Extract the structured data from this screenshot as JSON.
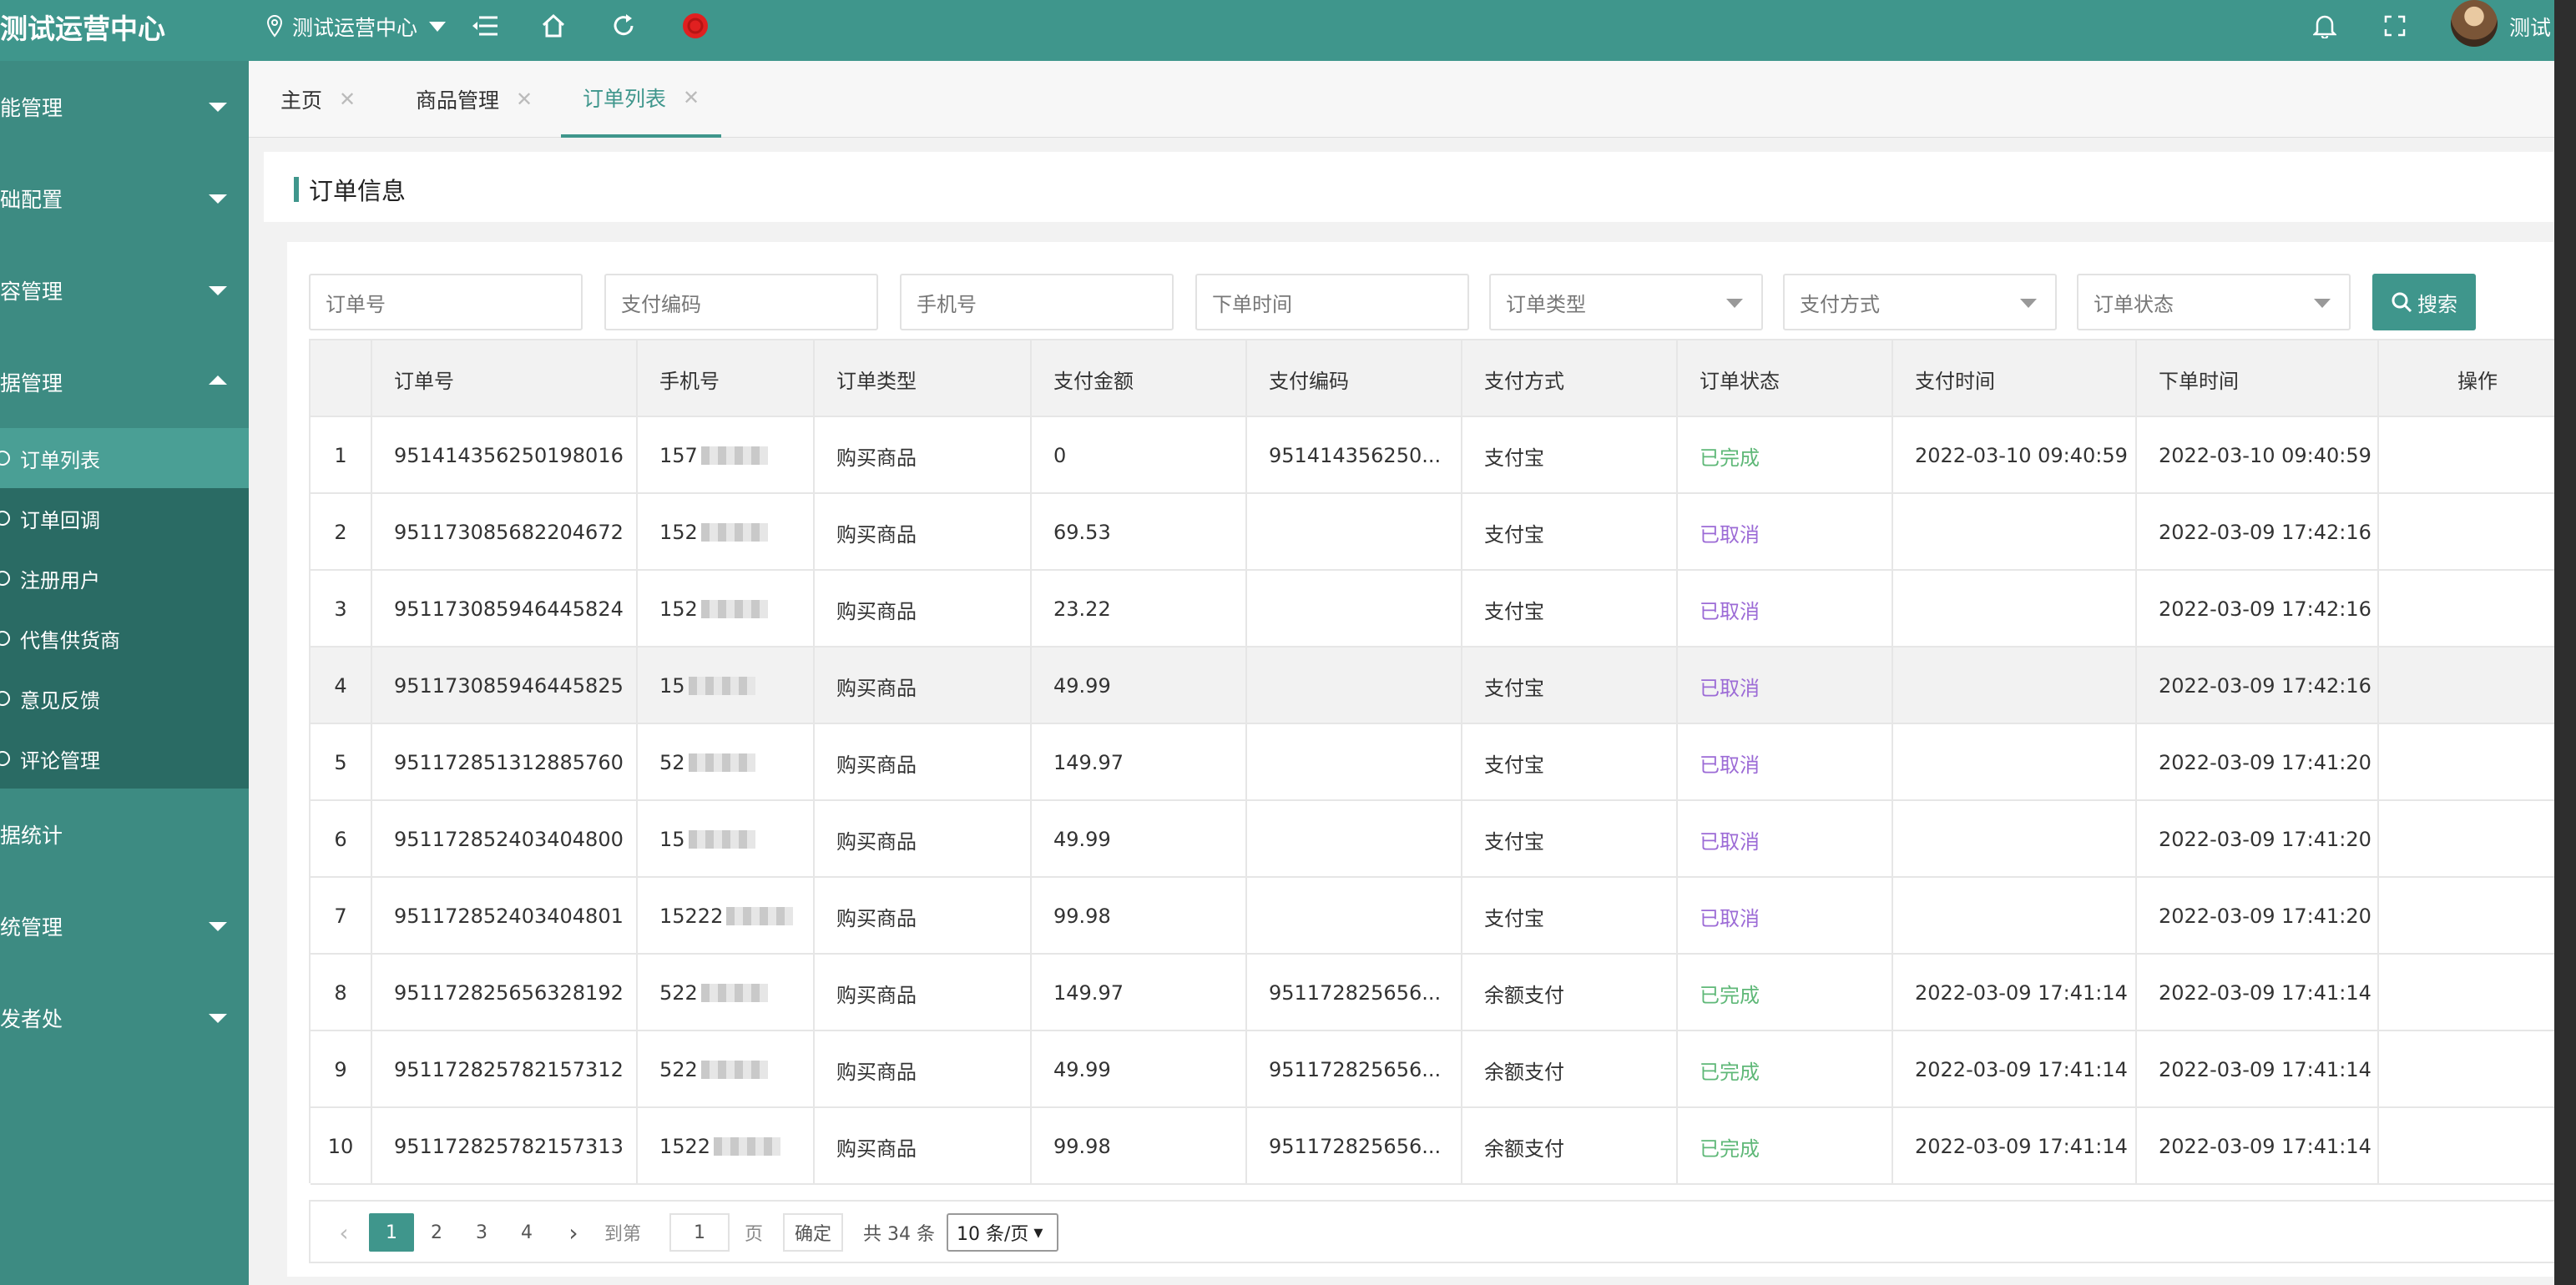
{
  "header": {
    "brand": "测试运营中心",
    "org": "测试运营中心",
    "user": "测试"
  },
  "sidebar": {
    "groups": [
      {
        "label": "能管理"
      },
      {
        "label": "础配置"
      },
      {
        "label": "容管理"
      },
      {
        "label": "据管理"
      }
    ],
    "sub_items": [
      {
        "label": "订单列表"
      },
      {
        "label": "订单回调"
      },
      {
        "label": "注册用户"
      },
      {
        "label": "代售供货商"
      },
      {
        "label": "意见反馈"
      },
      {
        "label": "评论管理"
      }
    ],
    "after": [
      {
        "label": "据统计"
      },
      {
        "label": "统管理"
      },
      {
        "label": "发者处"
      }
    ]
  },
  "tabs": [
    {
      "label": "主页"
    },
    {
      "label": "商品管理"
    },
    {
      "label": "订单列表"
    }
  ],
  "panel": {
    "title": "订单信息"
  },
  "filters": {
    "order_no": "订单号",
    "pay_code": "支付编码",
    "phone": "手机号",
    "order_time": "下单时间",
    "order_type": "订单类型",
    "pay_method": "支付方式",
    "order_status": "订单状态",
    "search_label": "搜索"
  },
  "table": {
    "columns": [
      "",
      "订单号",
      "手机号",
      "订单类型",
      "支付金额",
      "支付编码",
      "支付方式",
      "订单状态",
      "支付时间",
      "下单时间",
      "操作"
    ],
    "rows": [
      [
        "1",
        "951414356250198016",
        "157",
        "购买商品",
        "0",
        "951414356250...",
        "支付宝",
        "已完成",
        "2022-03-10 09:40:59",
        "2022-03-10 09:40:59"
      ],
      [
        "2",
        "951173085682204672",
        "152",
        "购买商品",
        "69.53",
        "",
        "支付宝",
        "已取消",
        "",
        "2022-03-09 17:42:16"
      ],
      [
        "3",
        "951173085946445824",
        "152",
        "购买商品",
        "23.22",
        "",
        "支付宝",
        "已取消",
        "",
        "2022-03-09 17:42:16"
      ],
      [
        "4",
        "951173085946445825",
        "15",
        "购买商品",
        "49.99",
        "",
        "支付宝",
        "已取消",
        "",
        "2022-03-09 17:42:16"
      ],
      [
        "5",
        "951172851312885760",
        "52",
        "购买商品",
        "149.97",
        "",
        "支付宝",
        "已取消",
        "",
        "2022-03-09 17:41:20"
      ],
      [
        "6",
        "951172852403404800",
        "15",
        "购买商品",
        "49.99",
        "",
        "支付宝",
        "已取消",
        "",
        "2022-03-09 17:41:20"
      ],
      [
        "7",
        "951172852403404801",
        "15222",
        "购买商品",
        "99.98",
        "",
        "支付宝",
        "已取消",
        "",
        "2022-03-09 17:41:20"
      ],
      [
        "8",
        "951172825656328192",
        "522",
        "购买商品",
        "149.97",
        "951172825656...",
        "余额支付",
        "已完成",
        "2022-03-09 17:41:14",
        "2022-03-09 17:41:14"
      ],
      [
        "9",
        "951172825782157312",
        "522",
        "购买商品",
        "49.99",
        "951172825656...",
        "余额支付",
        "已完成",
        "2022-03-09 17:41:14",
        "2022-03-09 17:41:14"
      ],
      [
        "10",
        "951172825782157313",
        "1522",
        "购买商品",
        "99.98",
        "951172825656...",
        "余额支付",
        "已完成",
        "2022-03-09 17:41:14",
        "2022-03-09 17:41:14"
      ]
    ]
  },
  "pagination": {
    "pages": [
      "1",
      "2",
      "3",
      "4"
    ],
    "goto_label": "到第",
    "goto_value": "1",
    "page_unit": "页",
    "confirm": "确定",
    "total": "共 34 条",
    "per_page": "10 条/页"
  },
  "colors": {
    "primary": "#3f968c",
    "done": "#5fb878",
    "cancel": "#9c6bd6"
  }
}
